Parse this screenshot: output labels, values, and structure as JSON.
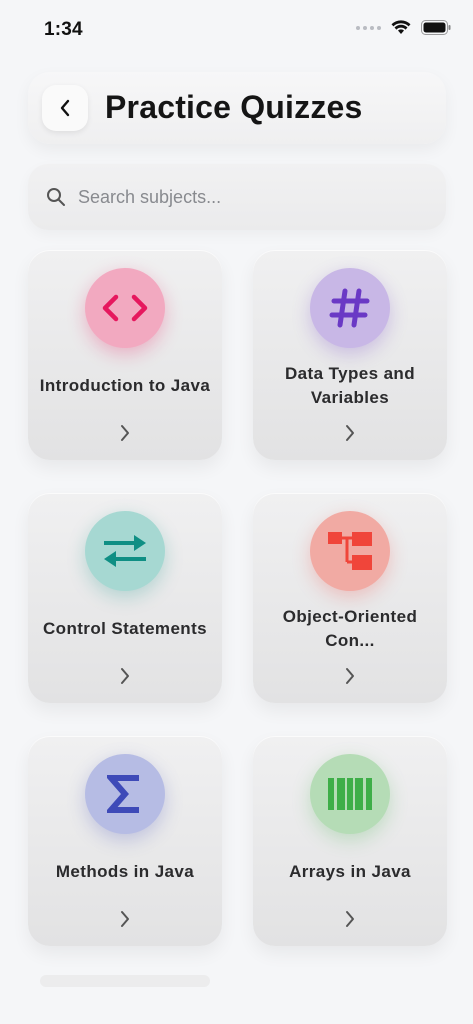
{
  "status_bar": {
    "time": "1:34"
  },
  "header": {
    "title": "Practice Quizzes"
  },
  "search": {
    "placeholder": "Search subjects..."
  },
  "subjects": [
    {
      "title": "Introduction to Java",
      "icon": "code-brackets-icon",
      "color": "#e6185e",
      "bg": "#f2a9c0"
    },
    {
      "title": "Data Types and Variables",
      "icon": "hash-icon",
      "color": "#6a39c5",
      "bg": "#c8b7e6"
    },
    {
      "title": "Control Statements",
      "icon": "swap-arrows-icon",
      "color": "#0f8f84",
      "bg": "#a6d8d2"
    },
    {
      "title": "Object-Oriented Con...",
      "icon": "hierarchy-icon",
      "color": "#f0453a",
      "bg": "#f1aaa3"
    },
    {
      "title": "Methods in Java",
      "icon": "sigma-icon",
      "color": "#3e4ab8",
      "bg": "#b6bce4"
    },
    {
      "title": "Arrays in Java",
      "icon": "array-bars-icon",
      "color": "#3eae48",
      "bg": "#b5dcb6"
    }
  ]
}
